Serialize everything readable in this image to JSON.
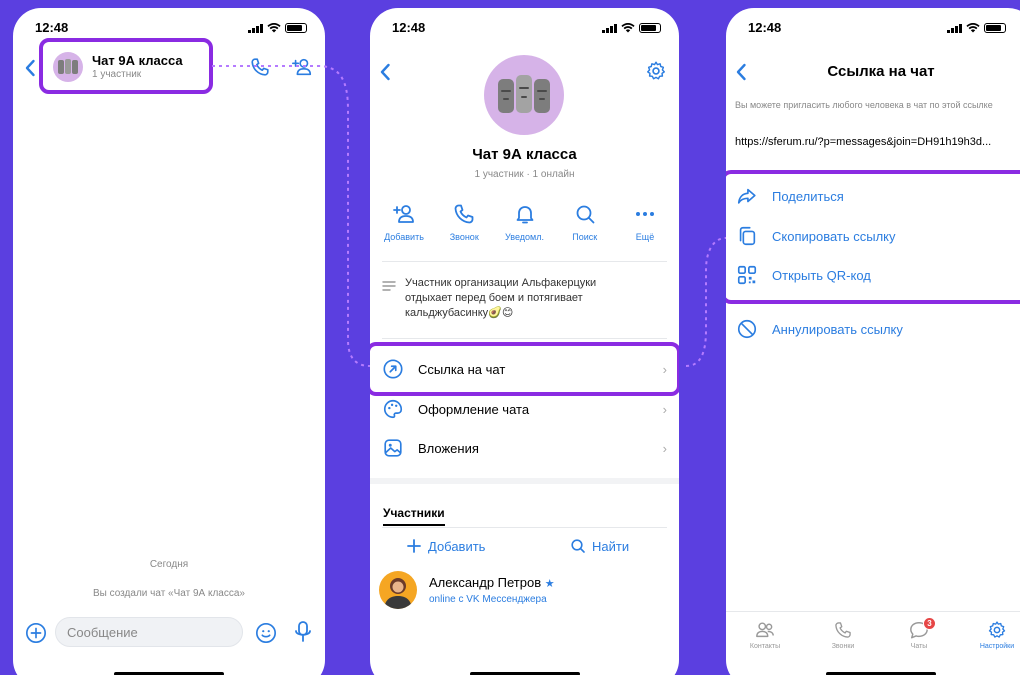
{
  "status_time": "12:48",
  "colors": {
    "accent": "#2b7de0",
    "highlight": "#8a2be2",
    "background": "#5b3fe0"
  },
  "chat_screen": {
    "title": "Чат 9А класса",
    "subtitle": "1 участник",
    "day_label": "Сегодня",
    "system_message": "Вы создали чат «Чат 9А класса»",
    "message_placeholder": "Сообщение"
  },
  "info_screen": {
    "title": "Чат 9А класса",
    "subtitle": "1 участник · 1 онлайн",
    "actions": [
      {
        "label": "Добавить",
        "icon": "add-person-icon"
      },
      {
        "label": "Звонок",
        "icon": "phone-icon"
      },
      {
        "label": "Уведомл.",
        "icon": "bell-icon"
      },
      {
        "label": "Поиск",
        "icon": "search-icon"
      },
      {
        "label": "Ещё",
        "icon": "more-icon"
      }
    ],
    "about": "Участник организации Альфакерцуки отдыхает перед боем и потягивает кальджубасинку🥑😊",
    "menu": [
      {
        "label": "Ссылка на чат",
        "icon": "link-icon"
      },
      {
        "label": "Оформление чата",
        "icon": "palette-icon"
      },
      {
        "label": "Вложения",
        "icon": "image-icon"
      }
    ],
    "members_section": "Участники",
    "add_label": "Добавить",
    "find_label": "Найти",
    "member": {
      "name": "Александр Петров",
      "status": "online с VK Мессенджера"
    }
  },
  "link_screen": {
    "title": "Ссылка на чат",
    "hint": "Вы можете пригласить любого человека в чат по этой ссылке",
    "link": "https://sferum.ru/?p=messages&join=DH91h19h3d...",
    "options": [
      {
        "label": "Поделиться",
        "icon": "share-icon"
      },
      {
        "label": "Скопировать ссылку",
        "icon": "copy-icon"
      },
      {
        "label": "Открыть QR-код",
        "icon": "qr-icon"
      }
    ],
    "revoke": "Аннулировать ссылку",
    "tabs": [
      {
        "label": "Контакты",
        "icon": "contacts-icon"
      },
      {
        "label": "Звонки",
        "icon": "phone-icon"
      },
      {
        "label": "Чаты",
        "icon": "chat-icon",
        "badge": "3"
      },
      {
        "label": "Настройки",
        "icon": "gear-icon"
      }
    ]
  }
}
